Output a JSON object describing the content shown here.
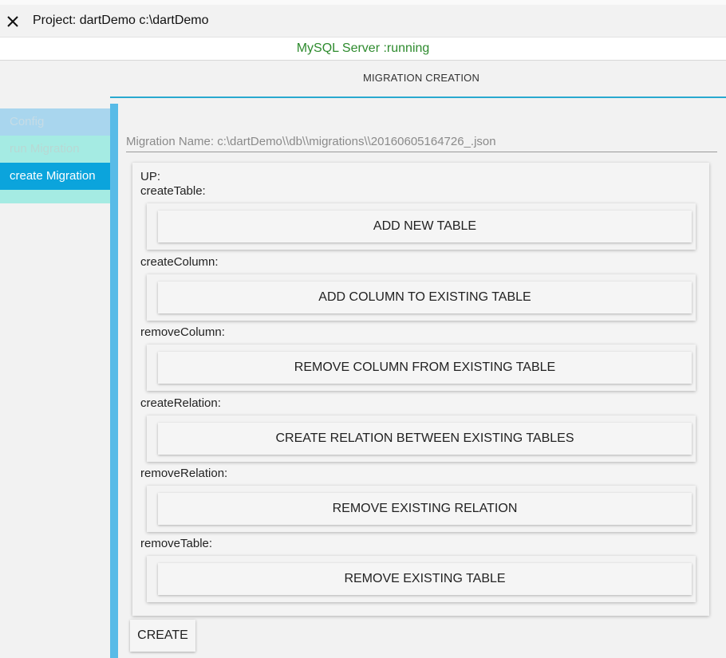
{
  "titlebar": {
    "project_title": "Project: dartDemo c:\\dartDemo"
  },
  "status": {
    "text": "MySQL Server :running",
    "color": "#2e8b2e"
  },
  "header": {
    "title": "MIGRATION CREATION",
    "accent_color": "#29a9cf"
  },
  "sidebar": {
    "items": [
      {
        "label": "Config",
        "state": "inactive",
        "bg": "#a9d6ee",
        "color": "#c6dce6"
      },
      {
        "label": "run Migration",
        "state": "inactive",
        "bg": "#a5ebe3",
        "color": "#b8d8d4"
      },
      {
        "label": "create Migration",
        "state": "active",
        "bg": "#0ba4dc",
        "color": "#ffffff"
      }
    ]
  },
  "migration": {
    "name_label": "Migration Name: c:\\dartDemo\\\\db\\\\migrations\\\\20160605164726_.json"
  },
  "up_section": {
    "label": "UP:",
    "groups": [
      {
        "label": "createTable:",
        "button": "ADD NEW TABLE"
      },
      {
        "label": "createColumn:",
        "button": "ADD COLUMN TO EXISTING TABLE"
      },
      {
        "label": "removeColumn:",
        "button": "REMOVE COLUMN FROM EXISTING TABLE"
      },
      {
        "label": "createRelation:",
        "button": "CREATE RELATION BETWEEN EXISTING TABLES"
      },
      {
        "label": "removeRelation:",
        "button": "REMOVE EXISTING RELATION"
      },
      {
        "label": "removeTable:",
        "button": "REMOVE EXISTING TABLE"
      }
    ]
  },
  "footer": {
    "create_label": "CREATE"
  }
}
